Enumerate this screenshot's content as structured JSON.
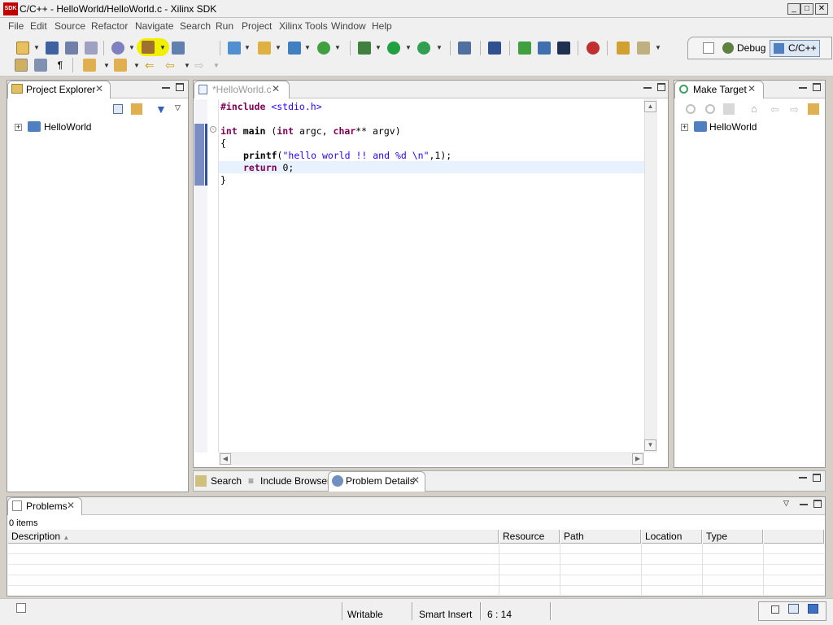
{
  "window": {
    "title": "C/C++ - HelloWorld/HelloWorld.c - Xilinx SDK",
    "logo": "SDK"
  },
  "menu": [
    "File",
    "Edit",
    "Source",
    "Refactor",
    "Navigate",
    "Search",
    "Run",
    "Project",
    "Xilinx Tools",
    "Window",
    "Help"
  ],
  "perspectives": {
    "debug": "Debug",
    "cpp": "C/C++"
  },
  "project_explorer": {
    "tab": "Project Explorer",
    "items": [
      "HelloWorld"
    ]
  },
  "editor": {
    "tab": "*HelloWorld.c",
    "lines": [
      {
        "a": "#include ",
        "b": "<stdio.h>"
      },
      {
        "a": "",
        "b": ""
      },
      {
        "kw1": "int",
        "t1": " ",
        "bold": "main",
        "t2": " (",
        "kw2": "int",
        "t3": " argc, ",
        "kw3": "char",
        "t4": "** argv)"
      },
      {
        "a": "{",
        "b": ""
      },
      {
        "call": "printf",
        "open": "(",
        "s": "\"hello world !! and %d \\n\"",
        "rest": ",1);"
      },
      {
        "kw": "return",
        "rest": " 0;"
      },
      {
        "a": "}",
        "b": ""
      }
    ]
  },
  "make_target": {
    "tab": "Make Target",
    "items": [
      "HelloWorld"
    ]
  },
  "bottom_tabs": [
    "Search",
    "Include Browser",
    "Problem Details"
  ],
  "problems": {
    "tab": "Problems",
    "count": "0 items",
    "columns": [
      "Description",
      "Resource",
      "Path",
      "Location",
      "Type"
    ]
  },
  "status": {
    "writable": "Writable",
    "insert": "Smart Insert",
    "position": "6 : 14"
  },
  "colors": {
    "highlight": "#f0f000",
    "keyword": "#7f0055",
    "string": "#2a00ff"
  }
}
